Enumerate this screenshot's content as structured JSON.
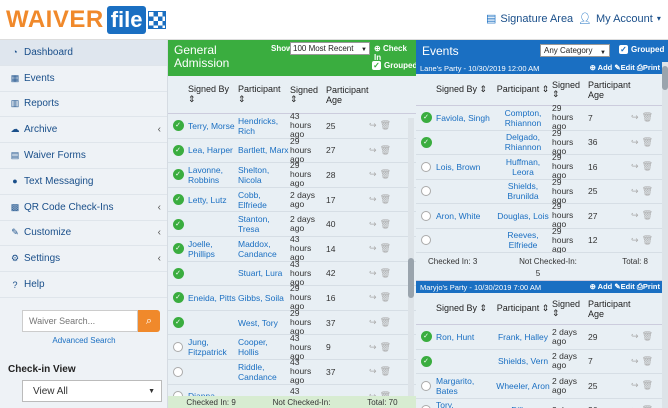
{
  "topbar": {
    "logo_text": "WAIVER",
    "logo_badge": "file",
    "signature_area": "Signature Area",
    "my_account": "My Account"
  },
  "sidebar": {
    "items": [
      {
        "label": "Dashboard",
        "icon": "dashboard-icon"
      },
      {
        "label": "Events",
        "icon": "calendar-icon"
      },
      {
        "label": "Reports",
        "icon": "bar-chart-icon"
      },
      {
        "label": "Archive",
        "icon": "cloud-icon",
        "chevron": "‹"
      },
      {
        "label": "Waiver Forms",
        "icon": "file-icon"
      },
      {
        "label": "Text Messaging",
        "icon": "chat-icon"
      },
      {
        "label": "QR Code Check-Ins",
        "icon": "qr-code-icon",
        "chevron": "‹"
      },
      {
        "label": "Customize",
        "icon": "edit-icon",
        "chevron": "‹"
      },
      {
        "label": "Settings",
        "icon": "gear-icon",
        "chevron": "‹"
      },
      {
        "label": "Help",
        "icon": "question-icon"
      }
    ],
    "search_placeholder": "Waiver Search...",
    "advanced_search": "Advanced Search",
    "checkin_view_label": "Check-in View",
    "checkin_view_value": "View All"
  },
  "general": {
    "title": "General Admission",
    "show_label": "Show",
    "show_value": "100 Most Recent",
    "checkin_label": "Check In",
    "grouped_label": "Grouped",
    "headers": {
      "signed_by": "Signed By",
      "participant": "Participant",
      "signed": "Signed",
      "age": "Participant Age"
    },
    "rows": [
      {
        "checked": true,
        "signed_by": "Terry, Morse",
        "participant": "Hendricks, Rich",
        "signed": "43 hours ago",
        "age": "25"
      },
      {
        "checked": true,
        "signed_by": "Lea, Harper",
        "participant": "Bartlett, Marx",
        "signed": "29 hours ago",
        "age": "27"
      },
      {
        "checked": true,
        "signed_by": "Lavonne, Robbins",
        "participant": "Shelton, Nicola",
        "signed": "29 hours ago",
        "age": "28"
      },
      {
        "checked": true,
        "signed_by": "Letty, Lutz",
        "participant": "Cobb, Elfriede",
        "signed": "2 days ago",
        "age": "17"
      },
      {
        "checked": true,
        "signed_by": "",
        "participant": "Stanton, Tresa",
        "signed": "2 days ago",
        "age": "40"
      },
      {
        "checked": true,
        "signed_by": "Joelle, Phillips",
        "participant": "Maddox, Candance",
        "signed": "43 hours ago",
        "age": "14"
      },
      {
        "checked": true,
        "signed_by": "",
        "participant": "Stuart, Lura",
        "signed": "43 hours ago",
        "age": "42"
      },
      {
        "checked": true,
        "signed_by": "Eneida, Pitts",
        "participant": "Gibbs, Soila",
        "signed": "29 hours ago",
        "age": "16"
      },
      {
        "checked": true,
        "signed_by": "",
        "participant": "West, Tory",
        "signed": "29 hours ago",
        "age": "37"
      },
      {
        "checked": false,
        "signed_by": "Jung, Fitzpatrick",
        "participant": "Cooper, Hollis",
        "signed": "43 hours ago",
        "age": "9"
      },
      {
        "checked": false,
        "signed_by": "",
        "participant": "Riddle, Candance",
        "signed": "43 hours ago",
        "age": "37"
      },
      {
        "checked": false,
        "signed_by": "Dianna,",
        "participant": "",
        "signed": "43 hours",
        "age": ""
      }
    ],
    "footer": {
      "checked_in": "Checked In: 9",
      "not_checked_in": "Not Checked-In:",
      "total": "Total: 70"
    }
  },
  "events": {
    "title": "Events",
    "category_value": "Any Category",
    "grouped_label": "Grouped",
    "groups": [
      {
        "name": "Lane's Party - 10/30/2019 12:00 AM",
        "add": "Add",
        "edit": "Edit",
        "print": "Print",
        "headers": {
          "signed_by": "Signed By",
          "participant": "Participant",
          "signed": "Signed",
          "age": "Participant Age"
        },
        "rows": [
          {
            "checked": true,
            "signed_by": "Faviola, Singh",
            "participant": "Compton, Rhiannon",
            "signed": "29 hours ago",
            "age": "7"
          },
          {
            "checked": true,
            "signed_by": "",
            "participant": "Delgado, Rhiannon",
            "signed": "29 hours ago",
            "age": "36"
          },
          {
            "checked": false,
            "signed_by": "Lois, Brown",
            "participant": "Huffman, Leora",
            "signed": "29 hours ago",
            "age": "16"
          },
          {
            "checked": false,
            "signed_by": "",
            "participant": "Shields, Brunilda",
            "signed": "29 hours ago",
            "age": "25"
          },
          {
            "checked": false,
            "signed_by": "Aron, White",
            "participant": "Douglas, Lois",
            "signed": "29 hours ago",
            "age": "27"
          },
          {
            "checked": false,
            "signed_by": "",
            "participant": "Reeves, Elfriede",
            "signed": "29 hours ago",
            "age": "12"
          }
        ],
        "footer": {
          "checked_in": "Checked In: 3",
          "not_checked_in": "Not Checked-In:",
          "not_checked_count": "5",
          "total": "Total: 8"
        }
      },
      {
        "name": "Maryjo's Party - 10/30/2019 7:00 AM",
        "add": "Add",
        "edit": "Edit",
        "print": "Print",
        "headers": {
          "signed_by": "Signed By",
          "participant": "Participant",
          "signed": "Signed",
          "age": "Participant Age"
        },
        "rows": [
          {
            "checked": true,
            "signed_by": "Ron, Hunt",
            "participant": "Frank, Halley",
            "signed": "2 days ago",
            "age": "29"
          },
          {
            "checked": true,
            "signed_by": "",
            "participant": "Shields, Vern",
            "signed": "2 days ago",
            "age": "7"
          },
          {
            "checked": false,
            "signed_by": "Margarito, Bates",
            "participant": "Wheeler, Aron",
            "signed": "2 days ago",
            "age": "25"
          },
          {
            "checked": false,
            "signed_by": "Tory, Fitzpatrick",
            "participant": "Dillon,",
            "signed": "2 days",
            "age": "36"
          }
        ]
      }
    ]
  },
  "colors": {
    "green": "#3aad3f",
    "blue": "#1a6fc2",
    "orange": "#f0892b"
  }
}
